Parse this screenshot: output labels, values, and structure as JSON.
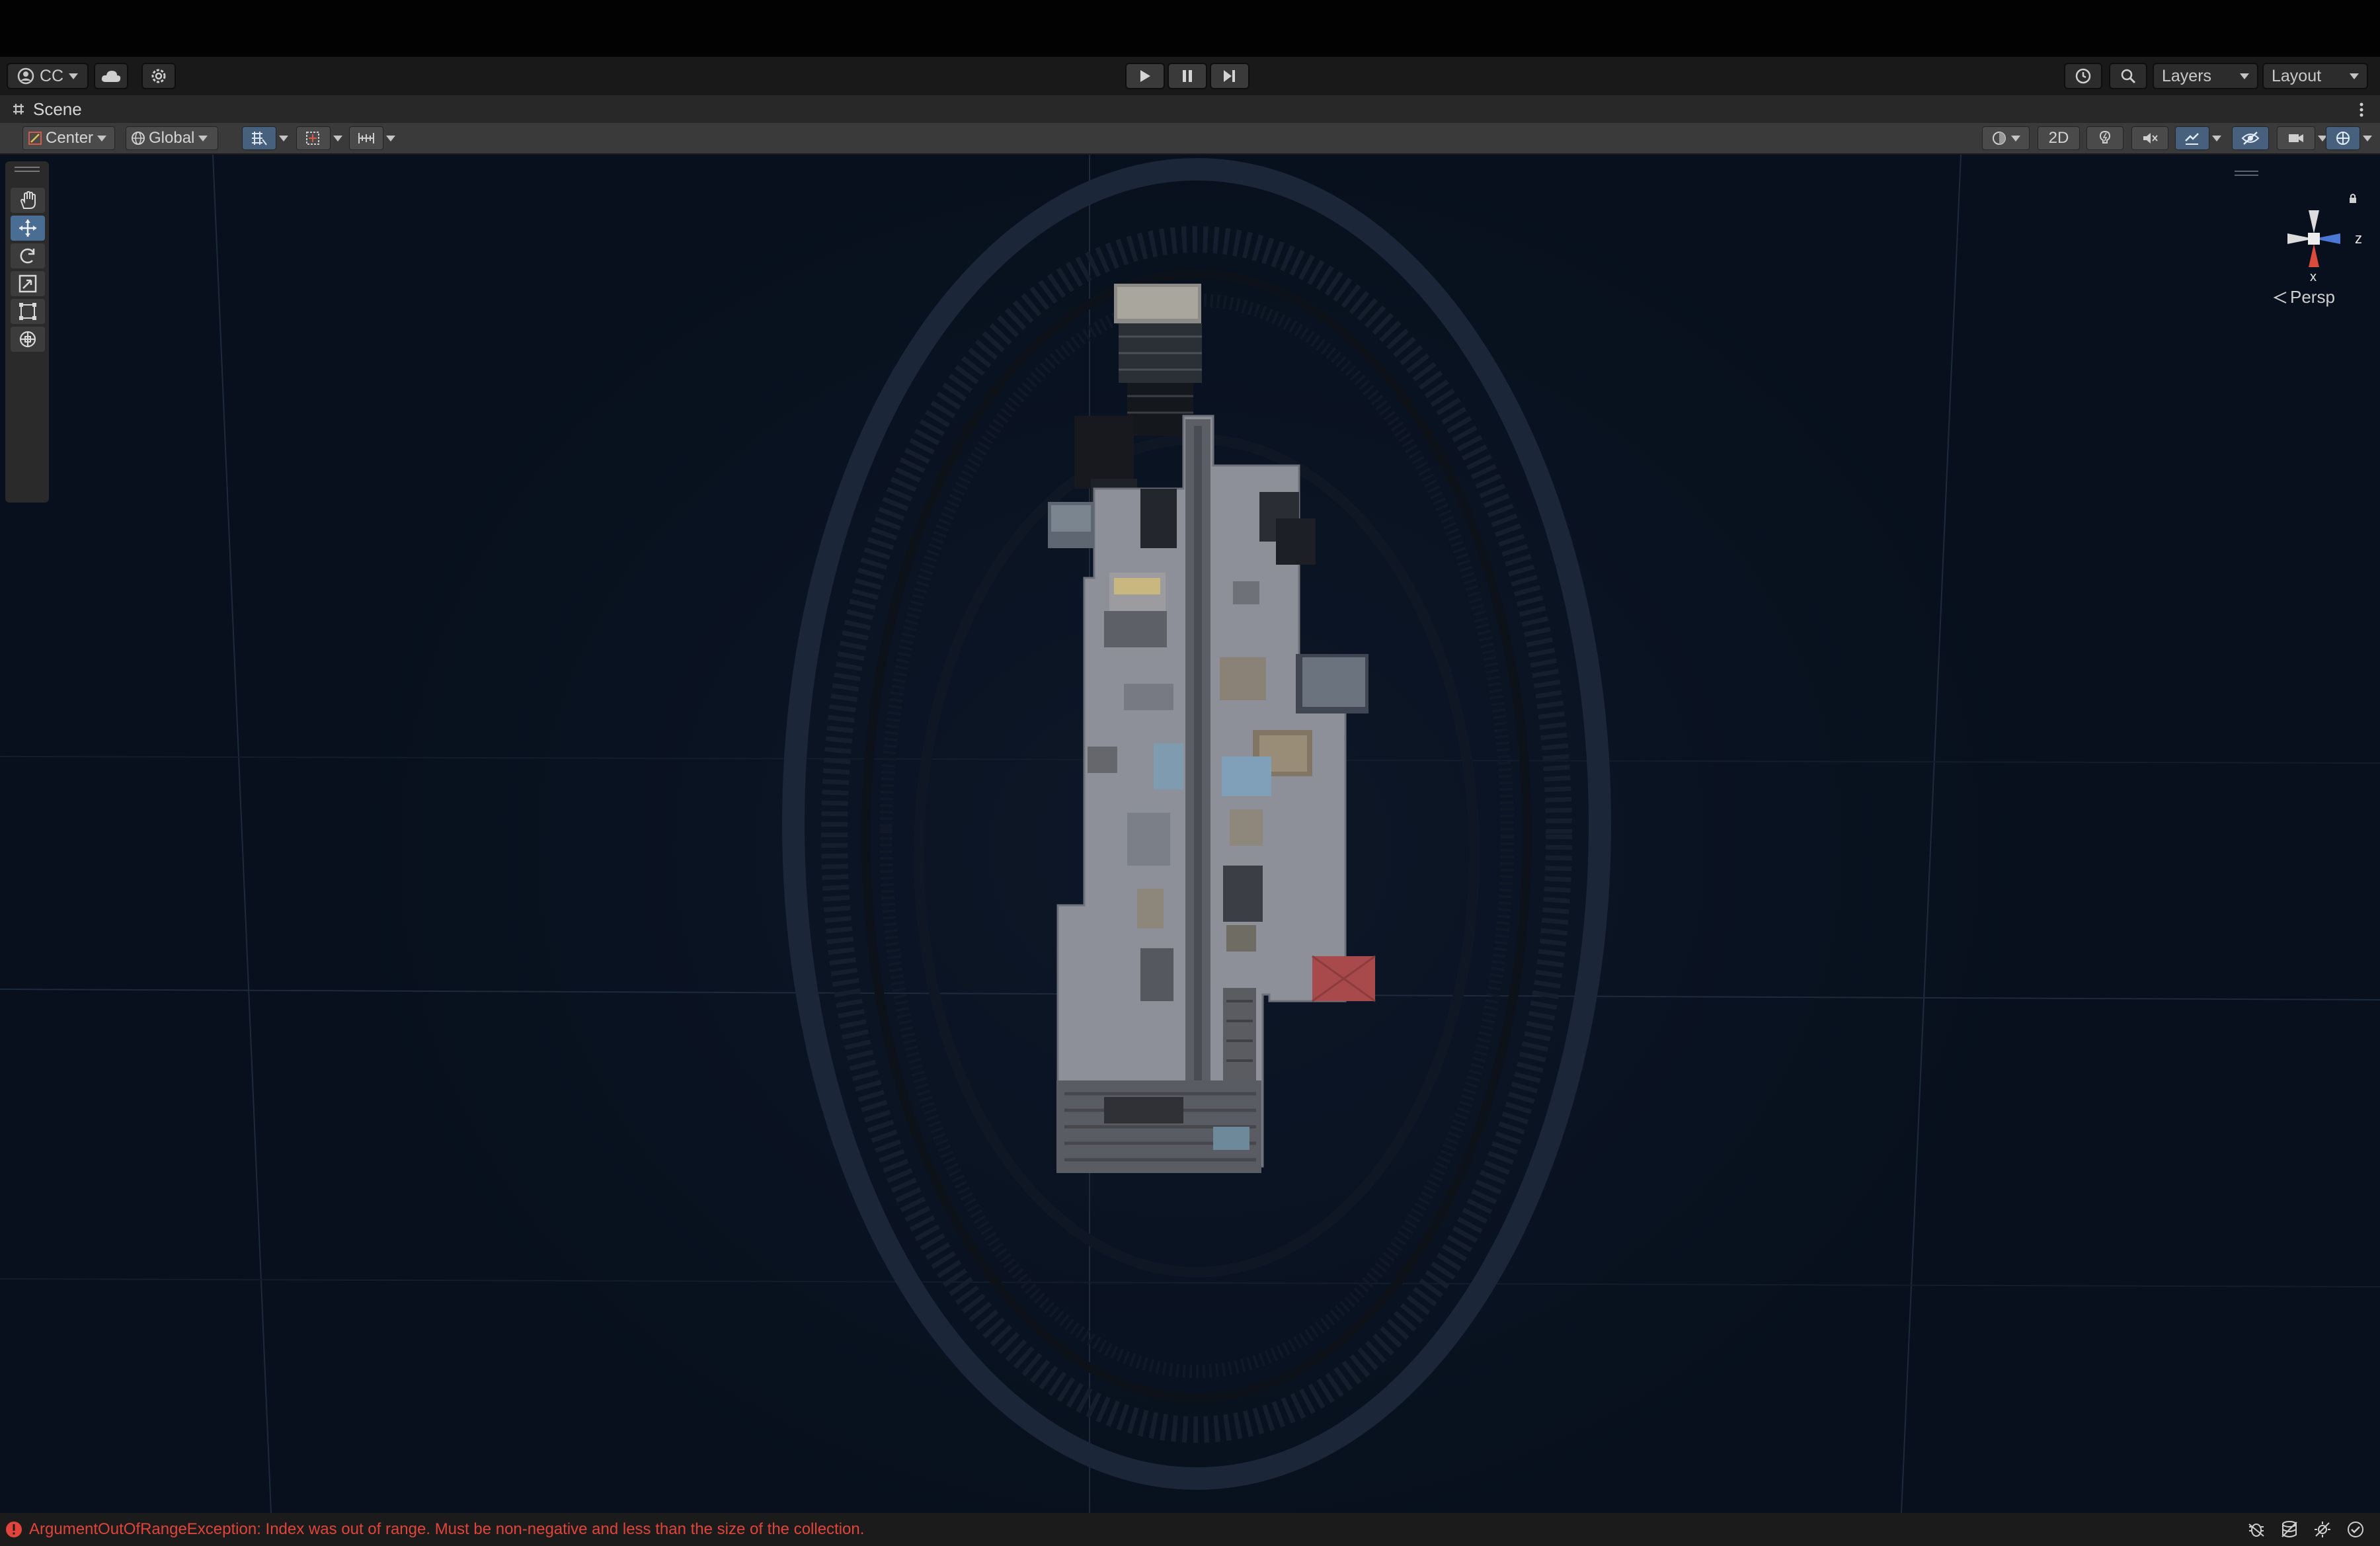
{
  "toolbar": {
    "account_label": "CC",
    "layers_label": "Layers",
    "layout_label": "Layout"
  },
  "scene_tab": {
    "title": "Scene"
  },
  "scene_toolbar": {
    "pivot_label": "Center",
    "space_label": "Global",
    "mode_2d_label": "2D"
  },
  "gizmo": {
    "axis_z": "z",
    "axis_x": "x",
    "projection_label": "Persp"
  },
  "console": {
    "error_message": "ArgumentOutOfRangeException: Index was out of range. Must be non-negative and less than the size of the collection."
  },
  "colors": {
    "accent_blue": "#4a6d94",
    "error_red": "#e0443a",
    "viewport_bg": "#0a1322"
  }
}
